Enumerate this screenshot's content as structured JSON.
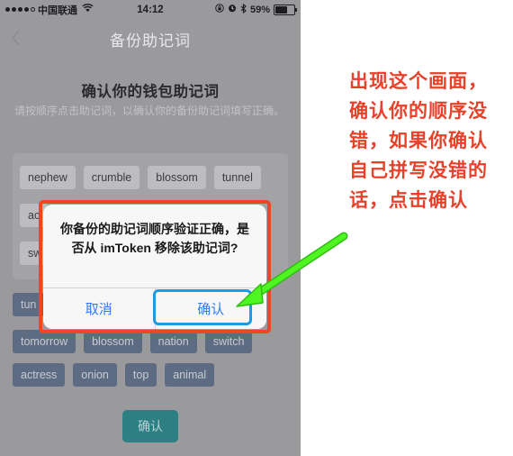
{
  "status_bar": {
    "carrier": "中国联通",
    "signal_dots_filled": 4,
    "signal_dots_total": 5,
    "wifi_icon": "wifi-icon",
    "time": "14:12",
    "lock_icon": "rotation-lock-icon",
    "alarm_icon": "alarm-clock-icon",
    "bluetooth_icon": "bluetooth-icon",
    "battery_percent": "59%"
  },
  "nav": {
    "back_icon": "chevron-left-icon",
    "title": "备份助记词"
  },
  "page": {
    "heading": "确认你的钱包助记词",
    "subtitle": "请按顺序点击助记词，以确认你的备份助记词填写正确。"
  },
  "selected_words": {
    "row1": [
      "nephew",
      "crumble",
      "blossom",
      "tunnel"
    ],
    "row2": [
      "ac",
      "",
      "",
      ""
    ],
    "row3": [
      "sw",
      "",
      "",
      ""
    ]
  },
  "word_bank": {
    "row1": [
      "tun"
    ],
    "row2": [
      "tomorrow",
      "blossom",
      "nation",
      "switch"
    ],
    "row3": [
      "actress",
      "onion",
      "top",
      "animal"
    ]
  },
  "bottom_button": {
    "label": "确认"
  },
  "dialog": {
    "message": "你备份的助记词顺序验证正确，是否从 imToken 移除该助记词?",
    "cancel_label": "取消",
    "confirm_label": "确认",
    "outline_color": "#ef4523",
    "highlight_color": "#1d9ae0",
    "button_text_color": "#2f7cf6"
  },
  "annotation": {
    "text": "出现这个画面，确认你的顺序没错，如果你确认自己拼写没错的话，点击确认",
    "color": "#e8412a",
    "arrow_color": "#3ce81a",
    "arrow_icon": "green-arrow-icon"
  }
}
